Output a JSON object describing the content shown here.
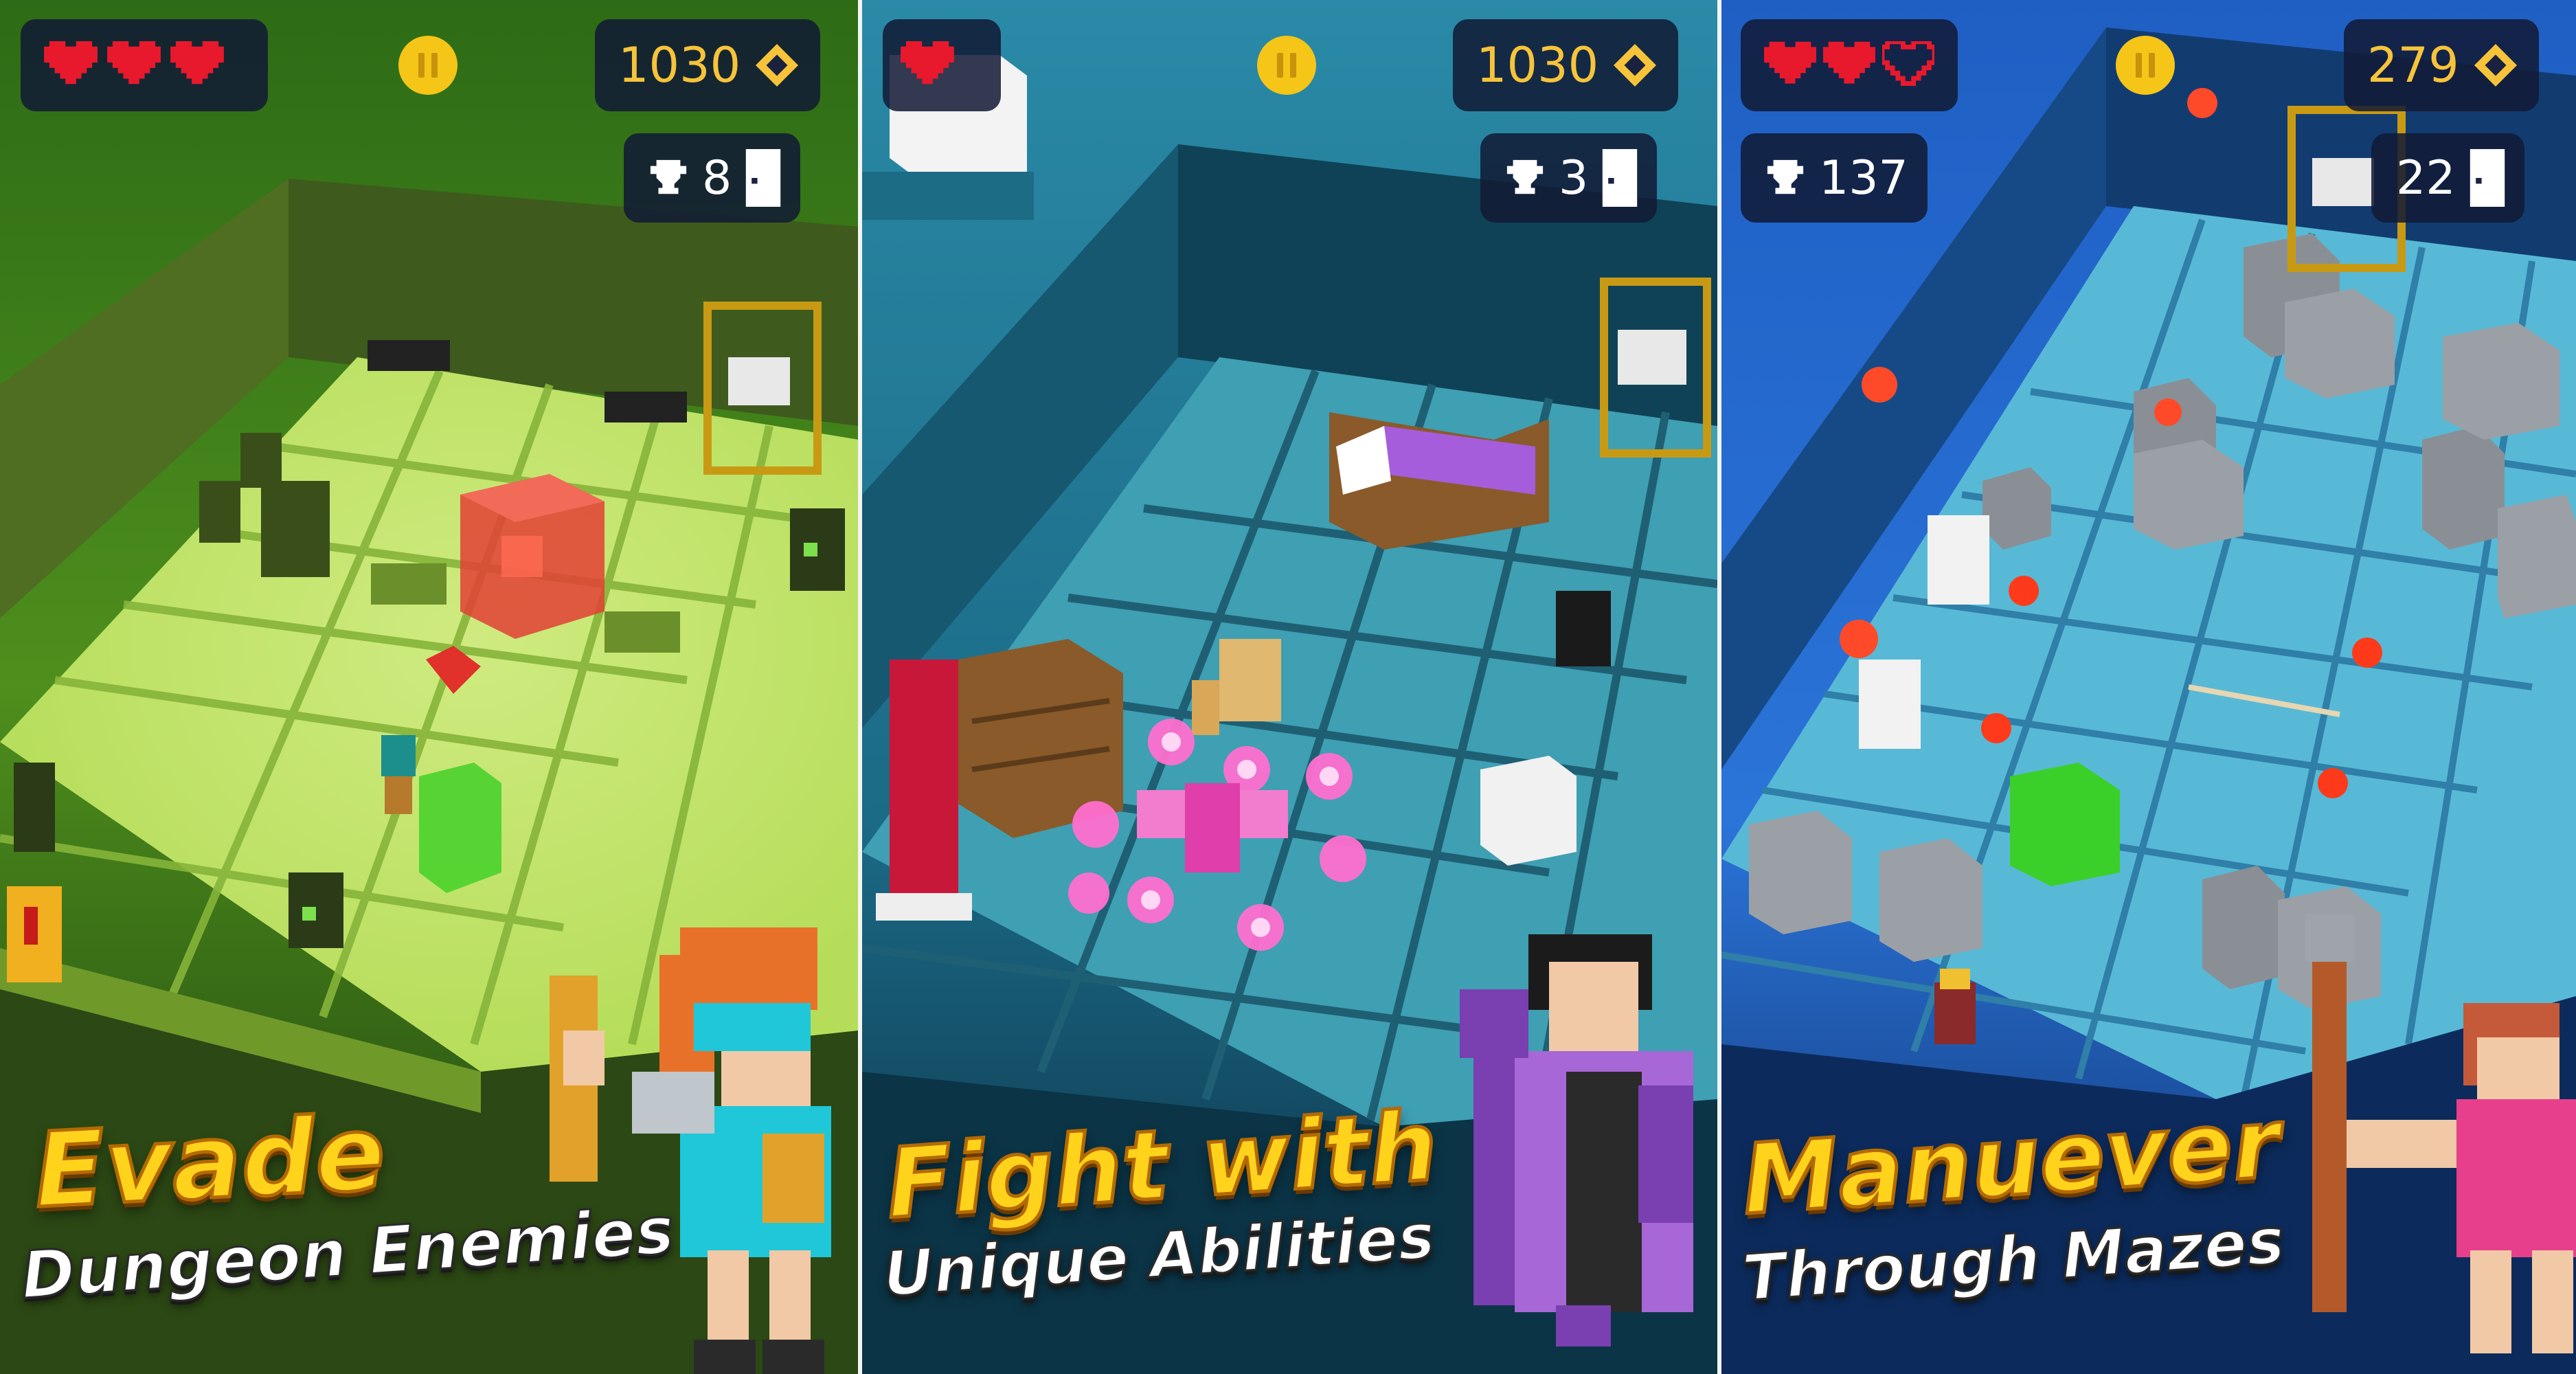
{
  "panels": [
    {
      "theme": "green",
      "hud": {
        "hearts_full": 3,
        "hearts_empty": 0,
        "coins": "1030",
        "trophies": "8",
        "doors": ""
      },
      "caption": {
        "title": "Evade",
        "subtitle": "Dungeon Enemies"
      }
    },
    {
      "theme": "teal",
      "hud": {
        "hearts_full": 1,
        "hearts_empty": 0,
        "coins": "1030",
        "trophies": "3",
        "doors": ""
      },
      "caption": {
        "title": "Fight with",
        "subtitle": "Unique Abilities"
      }
    },
    {
      "theme": "blue",
      "hud": {
        "hearts_full": 2,
        "hearts_empty": 1,
        "trophies": "137",
        "coins": "279",
        "doors": "22"
      },
      "caption": {
        "title": "Manuever",
        "subtitle": "Through Mazes"
      }
    }
  ],
  "colors": {
    "heart": "#e8192c",
    "coin_text": "#f6c33a",
    "pause": "#f5c518",
    "title_yellow": "#ffd21c",
    "green_floor": "#b6dd5a",
    "teal_floor": "#3f9fb3",
    "blue_floor": "#58b9d6"
  },
  "icons": [
    "heart-icon",
    "pause-icon",
    "diamond-coin-icon",
    "trophy-icon",
    "door-icon"
  ]
}
